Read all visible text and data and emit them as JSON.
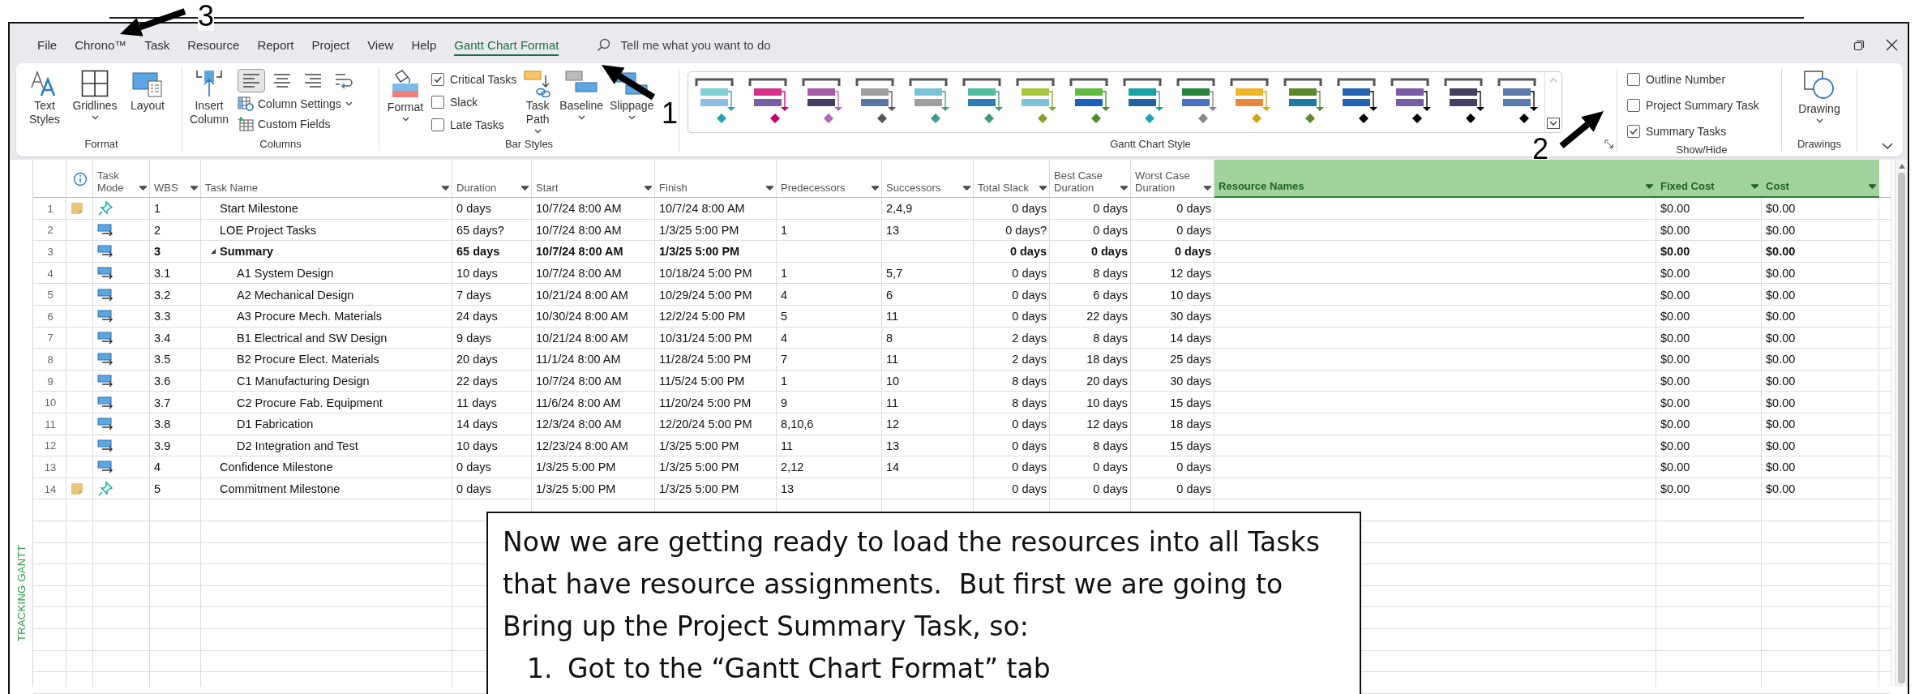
{
  "menu_tabs": [
    {
      "label": "File",
      "selected": false
    },
    {
      "label": "Chrono™",
      "selected": false
    },
    {
      "label": "Task",
      "selected": false
    },
    {
      "label": "Resource",
      "selected": false
    },
    {
      "label": "Report",
      "selected": false
    },
    {
      "label": "Project",
      "selected": false
    },
    {
      "label": "View",
      "selected": false
    },
    {
      "label": "Help",
      "selected": false
    },
    {
      "label": "Gantt Chart Format",
      "selected": true
    }
  ],
  "search": {
    "placeholder": "Tell me what you want to do"
  },
  "ribbon": {
    "format": {
      "label": "Format",
      "text_styles": "Text Styles",
      "gridlines": "Gridlines",
      "layout": "Layout"
    },
    "columns": {
      "label": "Columns",
      "insert_column": "Insert Column",
      "alignment": [
        {
          "kind": "left",
          "selected": true
        },
        {
          "kind": "center",
          "selected": false
        },
        {
          "kind": "right",
          "selected": false
        }
      ],
      "column_settings": "Column Settings",
      "custom_fields": "Custom Fields"
    },
    "bar_styles": {
      "label": "Bar Styles",
      "format": "Format",
      "checkboxes": [
        {
          "label": "Critical Tasks",
          "checked": true
        },
        {
          "label": "Slack",
          "checked": false
        },
        {
          "label": "Late Tasks",
          "checked": false
        }
      ],
      "task_path": "Task Path",
      "baseline": "Baseline",
      "slippage": "Slippage"
    },
    "gantt_chart_style": {
      "label": "Gantt Chart Style",
      "styles": [
        {
          "task_bar": {
            "color": "#7ecfd6"
          },
          "baseline_bar": {
            "color": "#8ebde8"
          },
          "milestone": {
            "color": "#2aa3b0"
          }
        },
        {
          "task_bar": {
            "color": "#d6318a"
          },
          "baseline_bar": {
            "color": "#7b5ea7"
          },
          "milestone": {
            "color": "#c8006e"
          }
        },
        {
          "task_bar": {
            "color": "#a55ca5"
          },
          "baseline_bar": {
            "color": "#433e62"
          },
          "milestone": {
            "color": "#b565b5"
          }
        },
        {
          "task_bar": {
            "color": "#9e9e9e"
          },
          "baseline_bar": {
            "color": "#5a76a6"
          },
          "milestone": {
            "color": "#555555"
          }
        },
        {
          "task_bar": {
            "color": "#7bc3d6"
          },
          "baseline_bar": {
            "color": "#9e9e9e"
          },
          "milestone": {
            "color": "#3e9c8e"
          }
        },
        {
          "task_bar": {
            "color": "#4fbfa0"
          },
          "baseline_bar": {
            "color": "#2c7cb5"
          },
          "milestone": {
            "color": "#3f9a7f"
          }
        },
        {
          "task_bar": {
            "color": "#a5c93a"
          },
          "baseline_bar": {
            "color": "#7cc3d6"
          },
          "milestone": {
            "color": "#86a030"
          }
        },
        {
          "task_bar": {
            "color": "#5dbb3f"
          },
          "baseline_bar": {
            "color": "#1c5fc0"
          },
          "milestone": {
            "color": "#4b8f2a"
          }
        },
        {
          "task_bar": {
            "color": "#17a2a6"
          },
          "baseline_bar": {
            "color": "#2460a8"
          },
          "milestone": {
            "color": "#1fa3b0"
          }
        },
        {
          "task_bar": {
            "color": "#27843a"
          },
          "baseline_bar": {
            "color": "#4b72c7"
          },
          "milestone": {
            "color": "#888888"
          }
        },
        {
          "task_bar": {
            "color": "#f0b429"
          },
          "baseline_bar": {
            "color": "#e8883a"
          },
          "milestone": {
            "color": "#d4a017"
          }
        },
        {
          "task_bar": {
            "color": "#5c8a2a"
          },
          "baseline_bar": {
            "color": "#1e7aa0"
          },
          "milestone": {
            "color": "#5c8a2a"
          }
        },
        {
          "task_bar": {
            "color": "#2462b3"
          },
          "baseline_bar": {
            "color": "#2462b3"
          },
          "milestone": {
            "color": "#000000"
          }
        },
        {
          "task_bar": {
            "color": "#7a5ca6"
          },
          "baseline_bar": {
            "color": "#7a5ca6"
          },
          "milestone": {
            "color": "#000000"
          }
        },
        {
          "task_bar": {
            "color": "#433e62"
          },
          "baseline_bar": {
            "color": "#433e62"
          },
          "milestone": {
            "color": "#000000"
          }
        },
        {
          "task_bar": {
            "color": "#5a7bab"
          },
          "baseline_bar": {
            "color": "#5a7bab"
          },
          "milestone": {
            "color": "#000000"
          }
        }
      ]
    },
    "show_hide": {
      "label": "Show/Hide",
      "checkboxes": [
        {
          "label": "Outline Number",
          "checked": false
        },
        {
          "label": "Project Summary Task",
          "checked": false
        },
        {
          "label": "Summary Tasks",
          "checked": true
        }
      ]
    },
    "drawings": {
      "label": "Drawings",
      "drawing": "Drawing"
    }
  },
  "view_label": "TRACKING GANTT",
  "table": {
    "columns": [
      {
        "label": "Task Mode",
        "selected": false
      },
      {
        "label": "WBS",
        "selected": false
      },
      {
        "label": "Task Name",
        "selected": false
      },
      {
        "label": "Duration",
        "selected": false
      },
      {
        "label": "Start",
        "selected": false
      },
      {
        "label": "Finish",
        "selected": false
      },
      {
        "label": "Predecessors",
        "selected": false
      },
      {
        "label": "Successors",
        "selected": false
      },
      {
        "label": "Total Slack",
        "selected": false
      },
      {
        "label": "Best Case Duration",
        "selected": false
      },
      {
        "label": "Worst Case Duration",
        "selected": false
      },
      {
        "label": "Resource Names",
        "selected": true
      },
      {
        "label": "Fixed Cost",
        "selected": true
      },
      {
        "label": "Cost",
        "selected": true
      }
    ],
    "rows": [
      {
        "id": "1",
        "note": true,
        "kind": "manual",
        "wbs": "1",
        "name": "Start Milestone",
        "duration": "0 days",
        "start": "10/7/24 8:00 AM",
        "finish": "10/7/24 8:00 AM",
        "successors": "2,4,9",
        "total_slack": "0 days",
        "best_case_duration": "0 days",
        "worst_case_duration": "0 days",
        "fixed_cost": "$0.00",
        "cost": "$0.00"
      },
      {
        "id": "2",
        "note": false,
        "kind": "auto",
        "wbs": "2",
        "name": "LOE Project Tasks",
        "duration": "65 days?",
        "start": "10/7/24 8:00 AM",
        "finish": "1/3/25 5:00 PM",
        "predecessors": "1",
        "successors": "13",
        "total_slack": "0 days?",
        "best_case_duration": "0 days",
        "worst_case_duration": "0 days",
        "fixed_cost": "$0.00",
        "cost": "$0.00"
      },
      {
        "id": "3",
        "note": false,
        "kind": "auto",
        "wbs": "3",
        "name": "Summary",
        "expanded": true,
        "duration": "65 days",
        "start": "10/7/24 8:00 AM",
        "finish": "1/3/25 5:00 PM",
        "total_slack": "0 days",
        "best_case_duration": "0 days",
        "worst_case_duration": "0 days",
        "fixed_cost": "$0.00",
        "cost": "$0.00",
        "children": [
          {
            "id": "4",
            "note": false,
            "kind": "auto",
            "wbs": "3.1",
            "name": "A1 System Design",
            "duration": "10 days",
            "start": "10/7/24 8:00 AM",
            "finish": "10/18/24 5:00 PM",
            "predecessors": "1",
            "successors": "5,7",
            "total_slack": "0 days",
            "best_case_duration": "8 days",
            "worst_case_duration": "12 days",
            "fixed_cost": "$0.00",
            "cost": "$0.00"
          },
          {
            "id": "5",
            "note": false,
            "kind": "auto",
            "wbs": "3.2",
            "name": "A2 Mechanical Design",
            "duration": "7 days",
            "start": "10/21/24 8:00 AM",
            "finish": "10/29/24 5:00 PM",
            "predecessors": "4",
            "successors": "6",
            "total_slack": "0 days",
            "best_case_duration": "6 days",
            "worst_case_duration": "10 days",
            "fixed_cost": "$0.00",
            "cost": "$0.00"
          },
          {
            "id": "6",
            "note": false,
            "kind": "auto",
            "wbs": "3.3",
            "name": "A3 Procure Mech. Materials",
            "duration": "24 days",
            "start": "10/30/24 8:00 AM",
            "finish": "12/2/24 5:00 PM",
            "predecessors": "5",
            "successors": "11",
            "total_slack": "0 days",
            "best_case_duration": "22 days",
            "worst_case_duration": "30 days",
            "fixed_cost": "$0.00",
            "cost": "$0.00"
          },
          {
            "id": "7",
            "note": false,
            "kind": "auto",
            "wbs": "3.4",
            "name": "B1 Electrical and SW Design",
            "duration": "9 days",
            "start": "10/21/24 8:00 AM",
            "finish": "10/31/24 5:00 PM",
            "predecessors": "4",
            "successors": "8",
            "total_slack": "2 days",
            "best_case_duration": "8 days",
            "worst_case_duration": "14 days",
            "fixed_cost": "$0.00",
            "cost": "$0.00"
          },
          {
            "id": "8",
            "note": false,
            "kind": "auto",
            "wbs": "3.5",
            "name": "B2 Procure Elect. Materials",
            "duration": "20 days",
            "start": "11/1/24 8:00 AM",
            "finish": "11/28/24 5:00 PM",
            "predecessors": "7",
            "successors": "11",
            "total_slack": "2 days",
            "best_case_duration": "18 days",
            "worst_case_duration": "25 days",
            "fixed_cost": "$0.00",
            "cost": "$0.00"
          },
          {
            "id": "9",
            "note": false,
            "kind": "auto",
            "wbs": "3.6",
            "name": "C1 Manufacturing Design",
            "duration": "22 days",
            "start": "10/7/24 8:00 AM",
            "finish": "11/5/24 5:00 PM",
            "predecessors": "1",
            "successors": "10",
            "total_slack": "8 days",
            "best_case_duration": "20 days",
            "worst_case_duration": "30 days",
            "fixed_cost": "$0.00",
            "cost": "$0.00"
          },
          {
            "id": "10",
            "note": false,
            "kind": "auto",
            "wbs": "3.7",
            "name": "C2 Procure Fab. Equipment",
            "duration": "11 days",
            "start": "11/6/24 8:00 AM",
            "finish": "11/20/24 5:00 PM",
            "predecessors": "9",
            "successors": "11",
            "total_slack": "8 days",
            "best_case_duration": "10 days",
            "worst_case_duration": "15 days",
            "fixed_cost": "$0.00",
            "cost": "$0.00"
          },
          {
            "id": "11",
            "note": false,
            "kind": "auto",
            "wbs": "3.8",
            "name": "D1 Fabrication",
            "duration": "14 days",
            "start": "12/3/24 8:00 AM",
            "finish": "12/20/24 5:00 PM",
            "predecessors": "8,10,6",
            "successors": "12",
            "total_slack": "0 days",
            "best_case_duration": "12 days",
            "worst_case_duration": "18 days",
            "fixed_cost": "$0.00",
            "cost": "$0.00"
          },
          {
            "id": "12",
            "note": false,
            "kind": "auto",
            "wbs": "3.9",
            "name": "D2 Integration and Test",
            "duration": "10 days",
            "start": "12/23/24 8:00 AM",
            "finish": "1/3/25 5:00 PM",
            "predecessors": "11",
            "successors": "13",
            "total_slack": "0 days",
            "best_case_duration": "8 days",
            "worst_case_duration": "15 days",
            "fixed_cost": "$0.00",
            "cost": "$0.00"
          }
        ]
      },
      {
        "id": "13",
        "note": false,
        "kind": "auto",
        "wbs": "4",
        "name": "Confidence Milestone",
        "duration": "0 days",
        "start": "1/3/25 5:00 PM",
        "finish": "1/3/25 5:00 PM",
        "predecessors": "2,12",
        "successors": "14",
        "total_slack": "0 days",
        "best_case_duration": "0 days",
        "worst_case_duration": "0 days",
        "fixed_cost": "$0.00",
        "cost": "$0.00"
      },
      {
        "id": "14",
        "note": true,
        "kind": "manual",
        "wbs": "5",
        "name": "Commitment Milestone",
        "duration": "0 days",
        "start": "1/3/25 5:00 PM",
        "finish": "1/3/25 5:00 PM",
        "predecessors": "13",
        "total_slack": "0 days",
        "best_case_duration": "0 days",
        "worst_case_duration": "0 days",
        "fixed_cost": "$0.00",
        "cost": "$0.00"
      }
    ]
  },
  "callout": {
    "paragraph": "Now we are getting ready to load the resources into all Tasks that have resource assignments.  But first we are going to Bring up the Project Summary Task, so:",
    "steps": [
      {
        "number": "1.",
        "text": "Got to the “Gantt Chart Format” tab"
      }
    ]
  },
  "annotations": [
    {
      "number": "1"
    },
    {
      "number": "2"
    },
    {
      "number": "3"
    }
  ]
}
